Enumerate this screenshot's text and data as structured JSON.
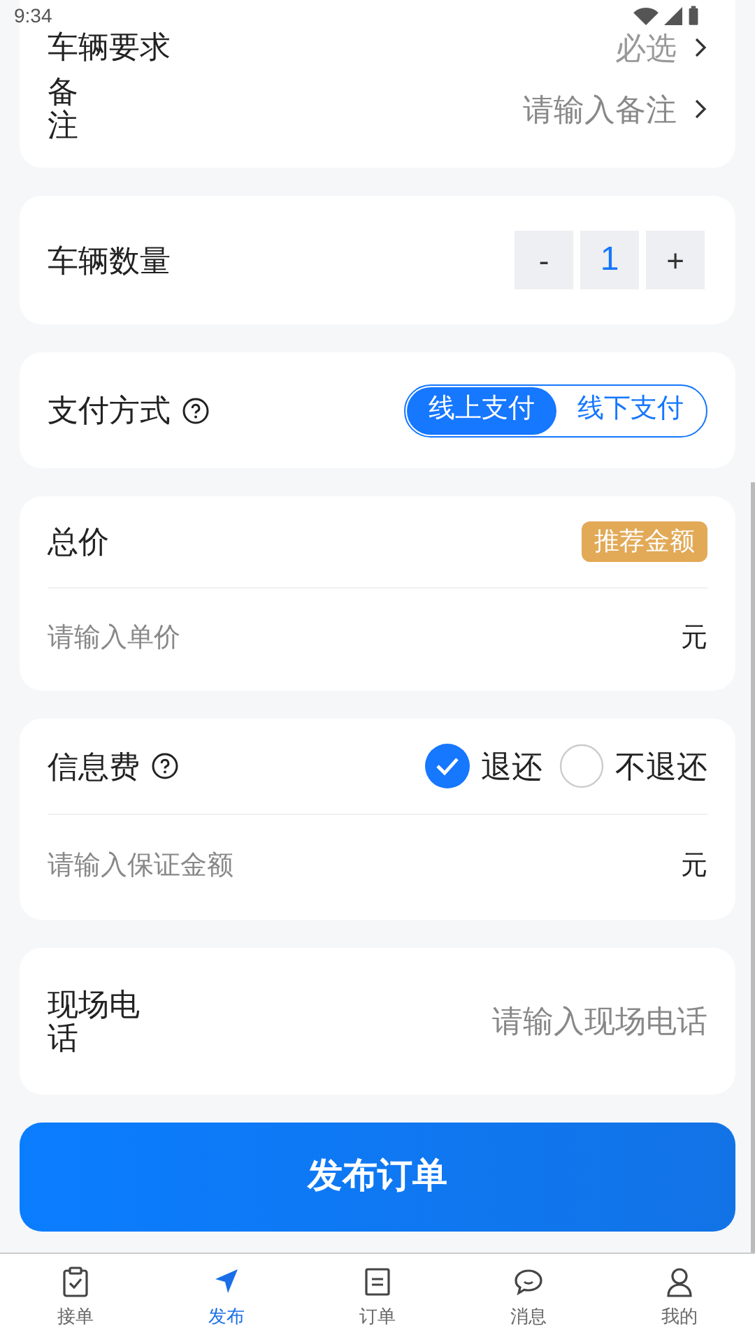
{
  "status_bar": {
    "time": "9:34"
  },
  "vehicle_card": {
    "rows": [
      {
        "kind": "select",
        "label": "车辆要求",
        "value": "必选"
      },
      {
        "kind": "input",
        "label": "备注",
        "placeholder": "请输入备注"
      }
    ]
  },
  "quantity": {
    "label": "车辆数量",
    "decrement": "-",
    "value": "1",
    "increment": "+"
  },
  "payment": {
    "label": "支付方式",
    "options": [
      {
        "label": "线上支付",
        "selected": true
      },
      {
        "label": "线下支付",
        "selected": false
      }
    ]
  },
  "price": {
    "label": "总价",
    "badge": "推荐金额",
    "placeholder": "请输入单价",
    "unit": "元"
  },
  "info_fee": {
    "label": "信息费",
    "options": [
      {
        "label": "退还",
        "selected": true
      },
      {
        "label": "不退还",
        "selected": false
      }
    ],
    "placeholder": "请输入保证金额",
    "unit": "元"
  },
  "site_phone": {
    "label": "现场电话",
    "placeholder": "请输入现场电话"
  },
  "submit": "发布订单",
  "nav": [
    {
      "label": "接单",
      "selected": false
    },
    {
      "label": "发布",
      "selected": true
    },
    {
      "label": "订单",
      "selected": false
    },
    {
      "label": "消息",
      "selected": false
    },
    {
      "label": "我的",
      "selected": false
    }
  ]
}
